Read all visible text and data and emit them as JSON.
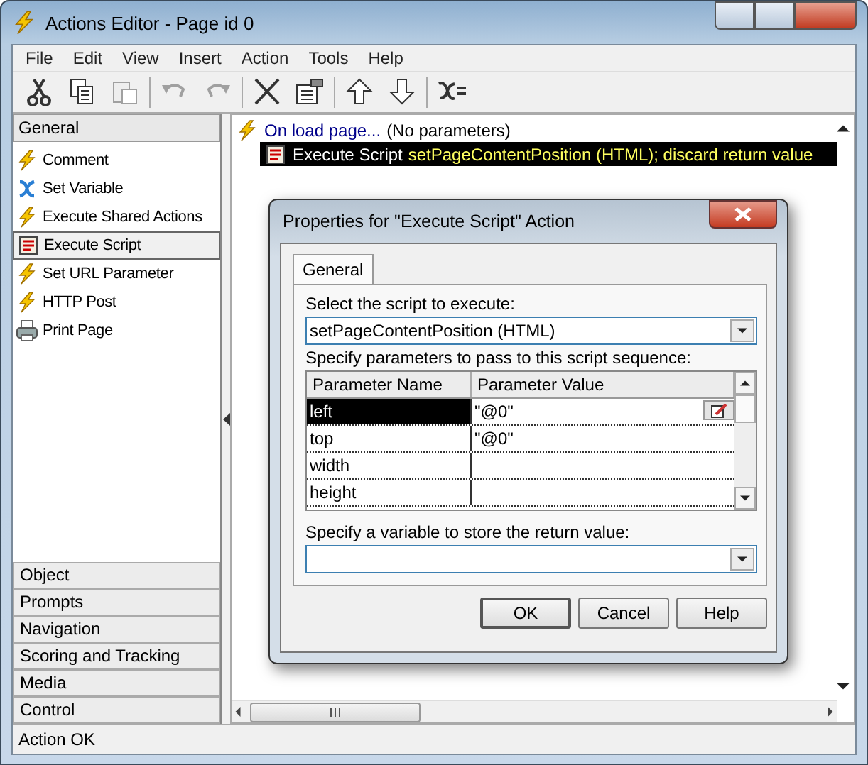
{
  "window": {
    "title": "Actions Editor - Page id 0"
  },
  "menu": [
    "File",
    "Edit",
    "View",
    "Insert",
    "Action",
    "Tools",
    "Help"
  ],
  "toolbar": [
    {
      "kind": "cut",
      "disabled": false
    },
    {
      "kind": "copy",
      "disabled": false
    },
    {
      "kind": "paste",
      "disabled": true
    },
    {
      "kind": "undo",
      "disabled": true
    },
    {
      "kind": "redo",
      "disabled": true
    },
    {
      "kind": "delete",
      "disabled": false
    },
    {
      "kind": "properties",
      "disabled": false
    },
    {
      "kind": "up",
      "disabled": false
    },
    {
      "kind": "down",
      "disabled": false
    },
    {
      "kind": "expression",
      "disabled": false
    }
  ],
  "sidebar": {
    "header": "General",
    "items": [
      {
        "label": "Comment",
        "kind": "action",
        "selected": false
      },
      {
        "label": "Set Variable",
        "kind": "variable",
        "selected": false
      },
      {
        "label": "Execute Shared Actions",
        "kind": "action",
        "selected": false
      },
      {
        "label": "Execute Script",
        "kind": "script",
        "selected": true
      },
      {
        "label": "Set URL Parameter",
        "kind": "action",
        "selected": false
      },
      {
        "label": "HTTP Post",
        "kind": "action",
        "selected": false
      },
      {
        "label": "Print Page",
        "kind": "print",
        "selected": false
      }
    ],
    "categories": [
      "Object",
      "Prompts",
      "Navigation",
      "Scoring and Tracking",
      "Media",
      "Control"
    ]
  },
  "actions": [
    {
      "label": "On load page...",
      "detail": "(No parameters)",
      "kind": "event",
      "selected": false,
      "children": [
        {
          "label": "Execute Script",
          "detail": "setPageContentPosition (HTML); discard return value",
          "kind": "script",
          "selected": true
        }
      ]
    }
  ],
  "dialog": {
    "title": "Properties for \"Execute Script\" Action",
    "tab": "General",
    "script_label": "Select the script to execute:",
    "script_value": "setPageContentPosition (HTML)",
    "params_label": "Specify parameters to pass to this script sequence:",
    "columns": [
      "Parameter Name",
      "Parameter Value"
    ],
    "rows": [
      {
        "name": "left",
        "value": "\"@0\"",
        "selected": true
      },
      {
        "name": "top",
        "value": "\"@0\"",
        "selected": false
      },
      {
        "name": "width",
        "selected": false
      },
      {
        "name": "height",
        "selected": false
      }
    ],
    "return_label": "Specify a variable to store the return value:",
    "buttons": [
      "OK",
      "Cancel",
      "Help"
    ]
  },
  "status_bar": "Action OK"
}
